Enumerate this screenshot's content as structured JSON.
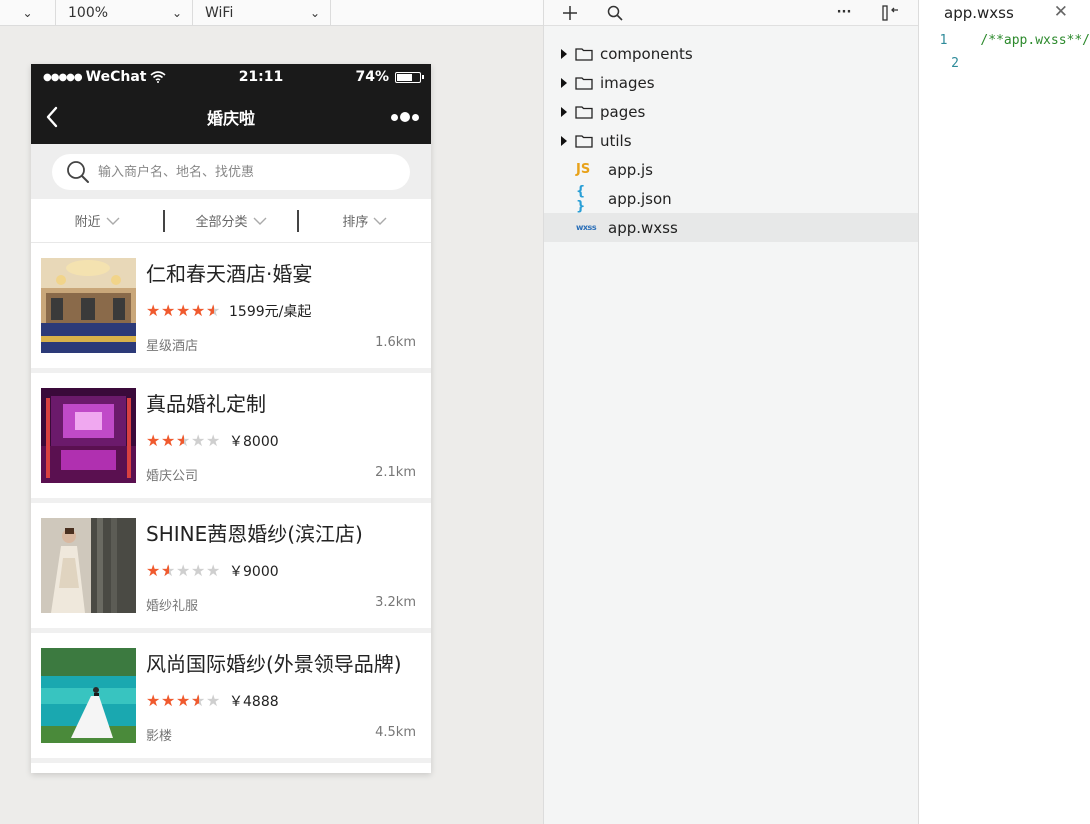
{
  "toolbar": {
    "zoom": "100%",
    "network": "WiFi"
  },
  "phone": {
    "status": {
      "carrier": "WeChat",
      "time": "21:11",
      "battery": "74%",
      "battery_level": 0.74
    },
    "nav": {
      "title": "婚庆啦"
    },
    "search": {
      "placeholder": "输入商户名、地名、找优惠"
    },
    "filters": [
      "附近",
      "全部分类",
      "排序"
    ],
    "items": [
      {
        "title": "仁和春天酒店·婚宴",
        "rating": 4.5,
        "price": "1599元/桌起",
        "category": "星级酒店",
        "distance": "1.6km",
        "thumb": "hotel-ballroom"
      },
      {
        "title": "真品婚礼定制",
        "rating": 2.5,
        "price": "￥8000",
        "category": "婚庆公司",
        "distance": "2.1km",
        "thumb": "purple-stage"
      },
      {
        "title": "SHINE茜恩婚纱(滨江店)",
        "rating": 1.5,
        "price": "￥9000",
        "category": "婚纱礼服",
        "distance": "3.2km",
        "thumb": "bridal-gown"
      },
      {
        "title": "风尚国际婚纱(外景领导品牌)",
        "rating": 3.5,
        "price": "￥4888",
        "category": "影楼",
        "distance": "4.5km",
        "thumb": "lake-couple"
      }
    ]
  },
  "filetree": {
    "items": [
      {
        "name": "components",
        "type": "folder"
      },
      {
        "name": "images",
        "type": "folder"
      },
      {
        "name": "pages",
        "type": "folder"
      },
      {
        "name": "utils",
        "type": "folder"
      },
      {
        "name": "app.js",
        "type": "js",
        "icon": "JS"
      },
      {
        "name": "app.json",
        "type": "json",
        "icon": "{ }"
      },
      {
        "name": "app.wxss",
        "type": "wxss",
        "icon": "wxss",
        "selected": true
      }
    ]
  },
  "editor": {
    "tab": "app.wxss",
    "lines": [
      {
        "num": "1",
        "text": "/**app.wxss**/"
      },
      {
        "num": "2",
        "text": ""
      }
    ]
  },
  "colors": {
    "star": "#f05a2e",
    "star_empty": "#cfcfcf",
    "navbar": "#1a1a1a",
    "comment": "#2d8a2d"
  }
}
